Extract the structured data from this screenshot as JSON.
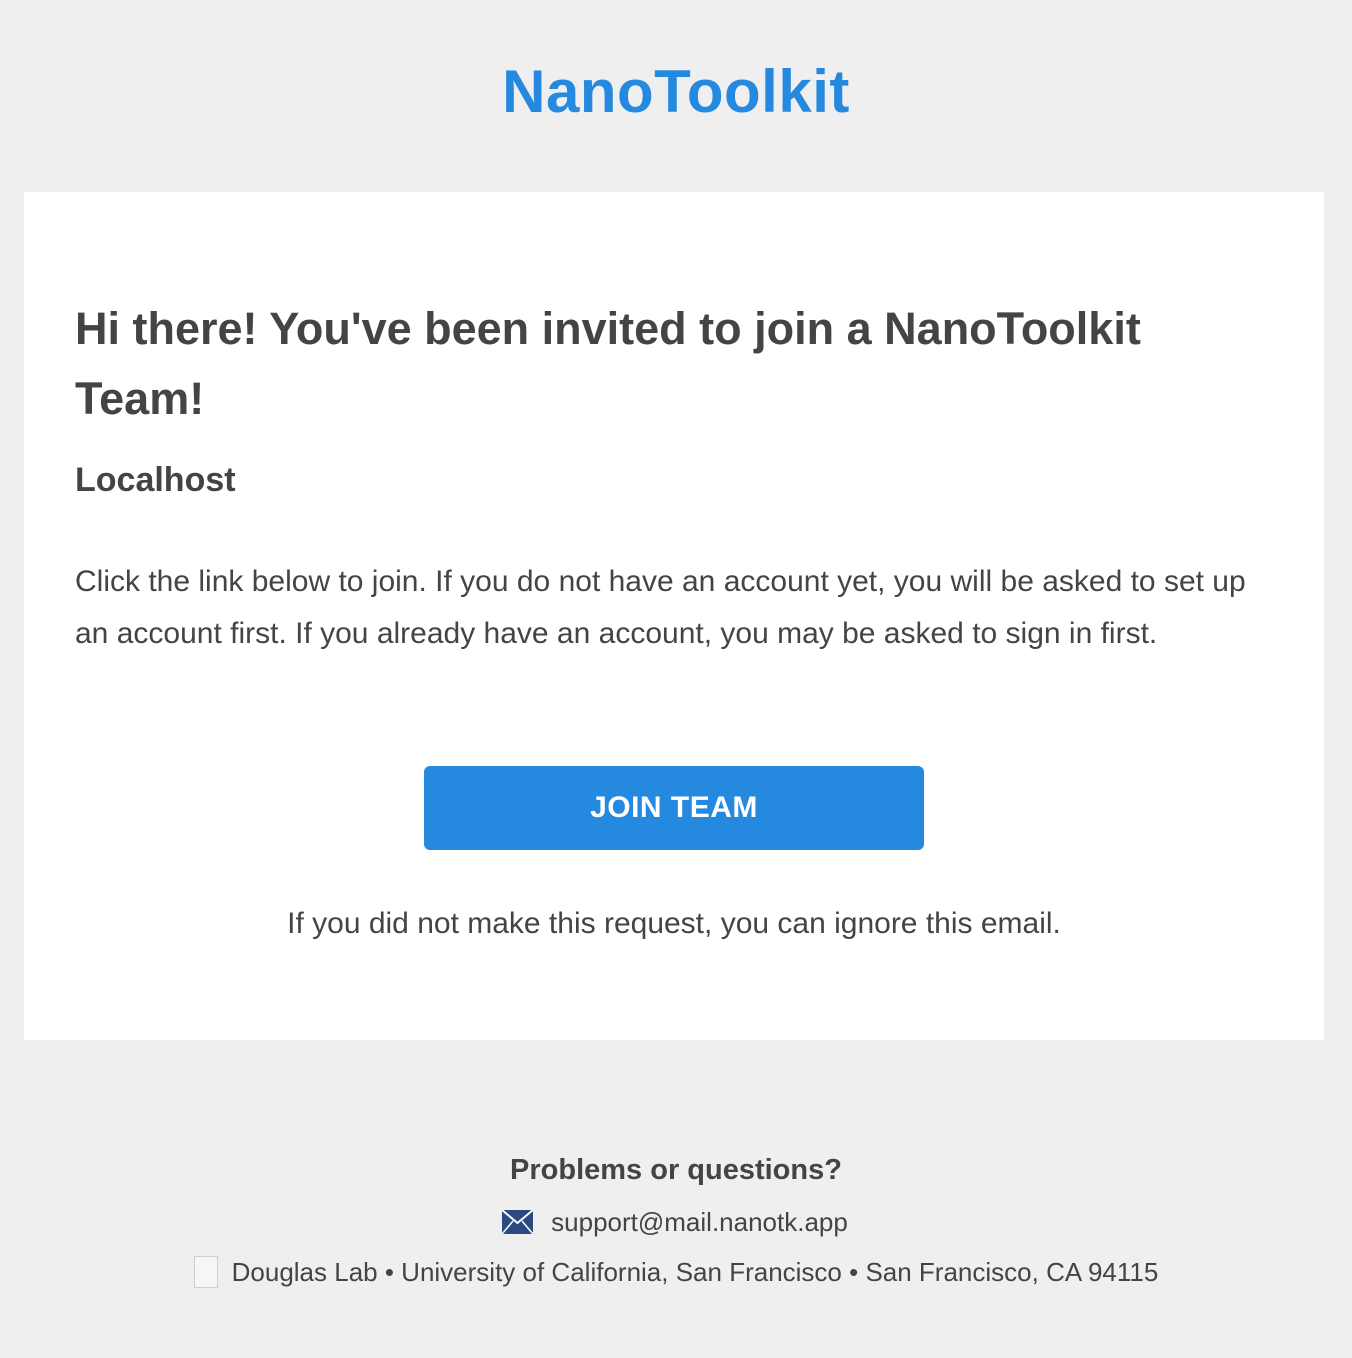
{
  "header": {
    "brand": "NanoToolkit"
  },
  "card": {
    "heading": "Hi there! You've been invited to join a NanoToolkit Team!",
    "team_name": "Localhost",
    "body": "Click the link below to join. If you do not have an account yet, you will be asked to set up an account first. If you already have an account, you may be asked to sign in first.",
    "button_label": "JOIN TEAM",
    "ignore_note": "If you did not make this request, you can ignore this email."
  },
  "footer": {
    "title": "Problems or questions?",
    "email": "support@mail.nanotk.app",
    "address": "Douglas Lab • University of California, San Francisco • San Francisco, CA 94115",
    "icons": {
      "email": "envelope-icon",
      "address": "image-placeholder-icon"
    }
  },
  "colors": {
    "brand": "#2589e0",
    "background": "#efefef",
    "card": "#ffffff",
    "text": "#444444",
    "button_text": "#ffffff",
    "mail_icon": "#2b4a82"
  }
}
